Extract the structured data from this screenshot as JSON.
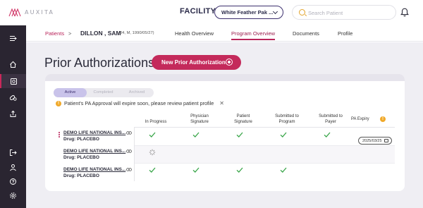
{
  "brand": {
    "name": "AUXITA",
    "accent": "#c42a5b",
    "sidebar_bg": "#2a2531"
  },
  "header": {
    "facility_label": "FACILITY",
    "facility_value": "White Feather Pak ...",
    "search_placeholder": "Search Patient",
    "icons": [
      "search-icon",
      "bell-icon"
    ]
  },
  "sidebar": {
    "items": [
      {
        "icon": "menu-toggle-icon",
        "active": false
      },
      {
        "icon": "home-icon",
        "active": false
      },
      {
        "icon": "prior-auth-icon",
        "active": true
      },
      {
        "icon": "pills-icon",
        "active": false
      },
      {
        "icon": "upload-icon",
        "active": false
      },
      {
        "icon": "logout-icon",
        "active": false
      },
      {
        "icon": "user-icon",
        "active": false
      },
      {
        "icon": "help-icon",
        "active": false
      },
      {
        "icon": "settings-icon",
        "active": false
      }
    ]
  },
  "breadcrumb": {
    "patients": "Patients",
    "separator": ">",
    "patient_name": "DILLON , SAM",
    "patient_meta": "(34, M, 1990/05/27)"
  },
  "patient_tabs": [
    {
      "label": "Health Overview",
      "active": false
    },
    {
      "label": "Program Overview",
      "active": true
    },
    {
      "label": "Documents",
      "active": false
    },
    {
      "label": "Profile",
      "active": false
    }
  ],
  "page": {
    "title": "Prior Authorizations",
    "new_button": "New Prior Authorization"
  },
  "status_tabs": [
    {
      "label": "Active",
      "active": true
    },
    {
      "label": "Completed",
      "active": false
    },
    {
      "label": "Archived",
      "active": false
    }
  ],
  "warning": {
    "text": "Patient's PA Approval will expire soon, please review patient profile",
    "close": "✕"
  },
  "columns": [
    {
      "l1": "In Progress",
      "l2": ""
    },
    {
      "l1": "Physician",
      "l2": "Signature"
    },
    {
      "l1": "Patient",
      "l2": "Signature"
    },
    {
      "l1": "Submitted to",
      "l2": "Program"
    },
    {
      "l1": "Submitted to",
      "l2": "Payer"
    },
    {
      "l1": "PA Expiry",
      "l2": ""
    }
  ],
  "rows": [
    {
      "program": "DEMO LIFE NATIONAL INS...",
      "drug": "Drug: PLACEBO",
      "statuses": [
        "check",
        "check",
        "check",
        "check",
        "check"
      ],
      "expiry": "2025/03/25"
    },
    {
      "program": "DEMO LIFE NATIONAL INS...",
      "drug": "Drug: PLACEBO",
      "statuses": [
        "spinner",
        "",
        "",
        "",
        ""
      ],
      "expiry": ""
    },
    {
      "program": "DEMO LIFE NATIONAL INS...",
      "drug": "Drug: PLACEBO",
      "statuses": [
        "check",
        "check",
        "check",
        "check",
        ""
      ],
      "expiry": ""
    }
  ]
}
